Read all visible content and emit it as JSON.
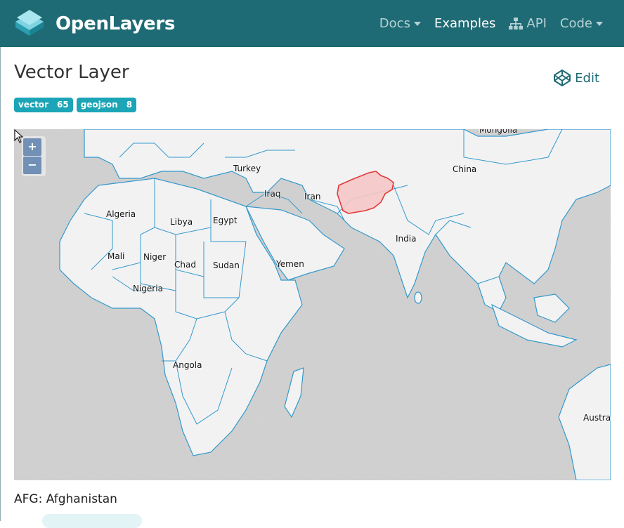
{
  "brand": {
    "name": "OpenLayers"
  },
  "nav": {
    "docs": "Docs",
    "examples": "Examples",
    "api": "API",
    "code": "Code"
  },
  "page": {
    "title": "Vector Layer",
    "edit_label": "Edit",
    "info_text": "AFG: Afghanistan"
  },
  "tags": [
    {
      "label": "vector",
      "count": "65"
    },
    {
      "label": "geojson",
      "count": "8"
    }
  ],
  "map": {
    "zoom_in": "+",
    "zoom_out": "−",
    "highlighted_country": "Afghanistan",
    "highlight_color": "#e23a3a",
    "border_color": "#3399cc",
    "labels": {
      "mongolia": "Mongolia",
      "turkey": "Turkey",
      "china": "China",
      "iraq": "Iraq",
      "iran": "Iran",
      "algeria": "Algeria",
      "libya": "Libya",
      "egypt": "Egypt",
      "india": "India",
      "mali": "Mali",
      "niger": "Niger",
      "chad": "Chad",
      "sudan": "Sudan",
      "yemen": "Yemen",
      "nigeria": "Nigeria",
      "angola": "Angola",
      "australia": "Austra"
    }
  },
  "colors": {
    "navbar": "#1f6b75",
    "tag": "#1ba5b7",
    "accent": "#1f6b75"
  }
}
